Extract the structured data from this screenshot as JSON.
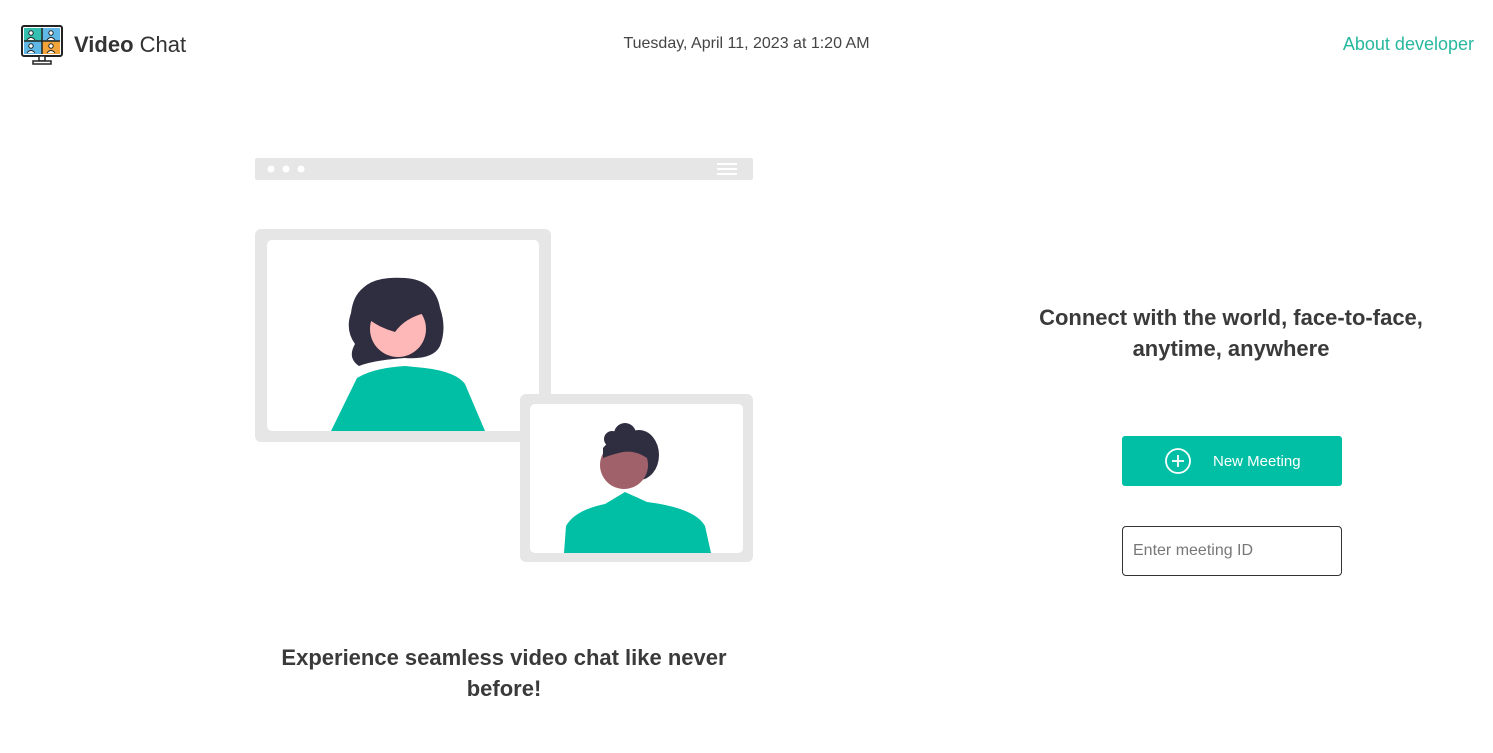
{
  "header": {
    "brand_bold": "Video",
    "brand_rest": "Chat",
    "datetime": "Tuesday, April 11, 2023 at 1:20 AM",
    "about_link": "About developer"
  },
  "hero": {
    "caption": "Experience seamless video chat like never before!"
  },
  "panel": {
    "tagline": "Connect with the world, face-to-face, anytime, anywhere",
    "new_meeting_label": "New Meeting",
    "meeting_id_placeholder": "Enter meeting ID",
    "meeting_id_value": ""
  },
  "icons": {
    "logo": "video-conference-monitor-icon",
    "new_meeting": "plus-circle-icon"
  },
  "colors": {
    "accent": "#00bfa5",
    "link": "#27b89d",
    "frame_gray": "#e6e6e6",
    "hair_dark": "#2f2e41",
    "skin_light": "#ffb8b8",
    "skin_dark": "#a0616a"
  }
}
